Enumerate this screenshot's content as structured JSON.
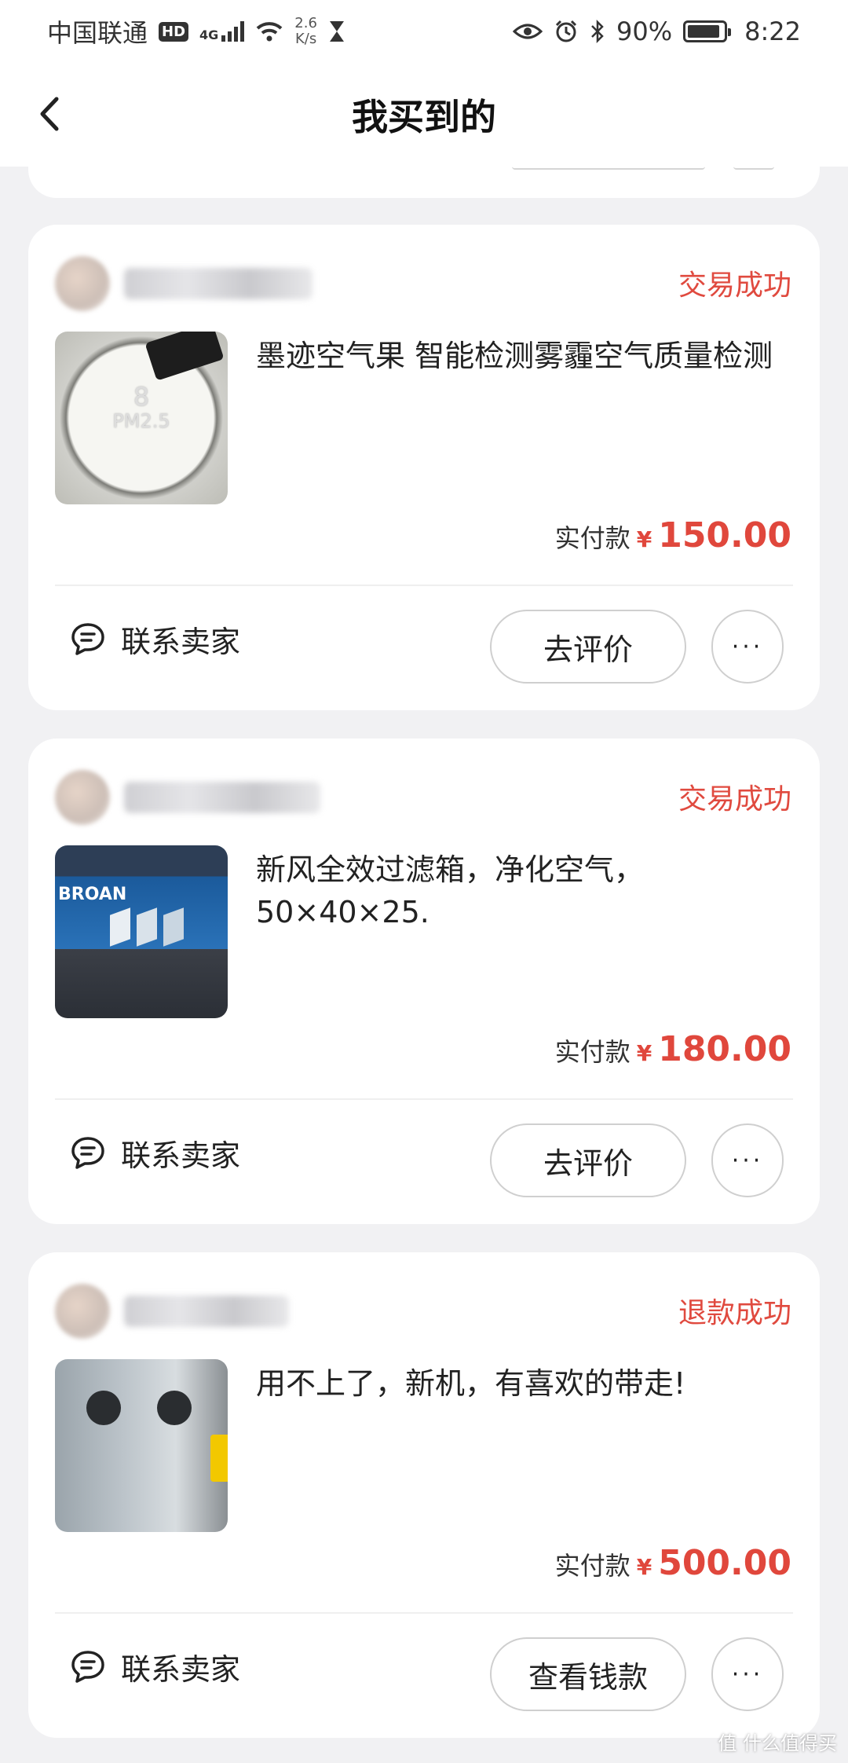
{
  "status_bar": {
    "carrier": "中国联通",
    "hd_badge": "HD",
    "network_type": "4G",
    "speed_value": "2.6",
    "speed_unit": "K/s",
    "battery": "90%",
    "time": "8:22"
  },
  "header": {
    "title": "我买到的"
  },
  "orders": [
    {
      "status": "交易成功",
      "description": "墨迹空气果 智能检测雾霾空气质量检测",
      "pay_label": "实付款",
      "currency": "¥",
      "amount": "150.00",
      "contact_label": "联系卖家",
      "action_label": "去评价",
      "more_label": "···",
      "thumb_text": "8",
      "thumb_subtext": "PM2.5"
    },
    {
      "status": "交易成功",
      "description": "新风全效过滤箱，净化空气，50×40×25.",
      "pay_label": "实付款",
      "currency": "¥",
      "amount": "180.00",
      "contact_label": "联系卖家",
      "action_label": "去评价",
      "more_label": "···",
      "thumb_text": "BROAN"
    },
    {
      "status": "退款成功",
      "description": "用不上了，新机，有喜欢的带走!",
      "pay_label": "实付款",
      "currency": "¥",
      "amount": "500.00",
      "contact_label": "联系卖家",
      "action_label": "查看钱款",
      "more_label": "···"
    }
  ],
  "watermark": "值 什么值得买",
  "colors": {
    "accent": "#e04a3f",
    "background": "#f1f1f3"
  }
}
